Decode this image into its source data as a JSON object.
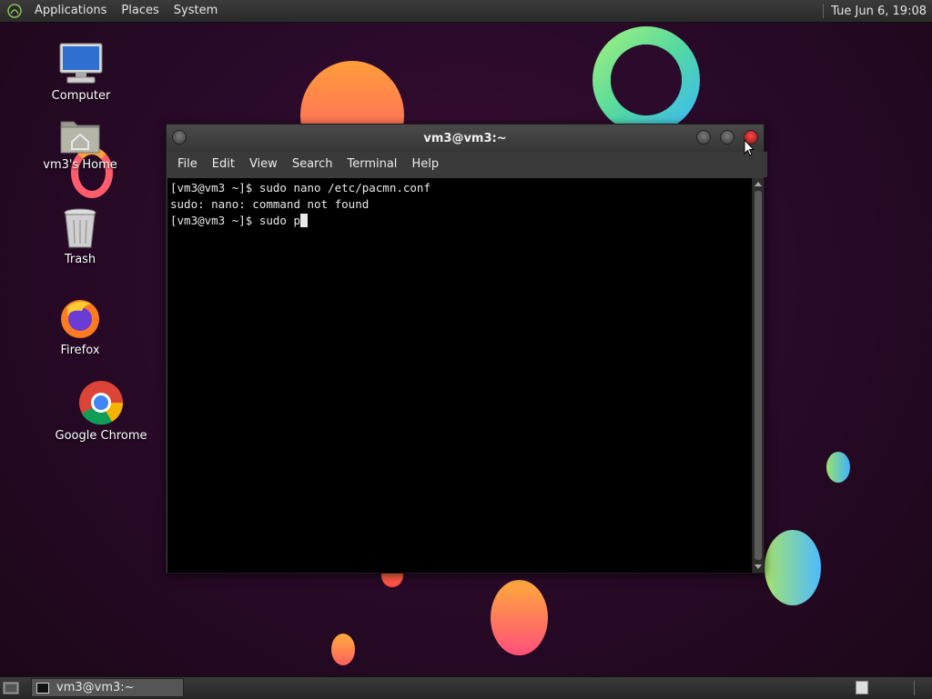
{
  "top_panel": {
    "menus": [
      "Applications",
      "Places",
      "System"
    ],
    "clock": "Tue Jun  6, 19:08",
    "logo_icon": "mate-logo-icon"
  },
  "desktop_icons": [
    {
      "label": "Computer",
      "icon": "computer-icon"
    },
    {
      "label": "vm3's Home",
      "icon": "home-folder-icon"
    },
    {
      "label": "Trash",
      "icon": "trash-icon"
    },
    {
      "label": "Firefox",
      "icon": "firefox-icon"
    },
    {
      "label": "Google Chrome",
      "icon": "chrome-icon"
    }
  ],
  "window": {
    "title": "vm3@vm3:~",
    "menu": [
      "File",
      "Edit",
      "View",
      "Search",
      "Terminal",
      "Help"
    ],
    "terminal_lines": [
      "[vm3@vm3 ~]$ sudo nano /etc/pacmn.conf",
      "sudo: nano: command not found",
      "[vm3@vm3 ~]$ sudo p"
    ],
    "close_color": "#e03030"
  },
  "bottom_panel": {
    "task_label": "vm3@vm3:~"
  },
  "colors": {
    "panel": "#2f2f2f",
    "wallpaper": "#2a0a2a",
    "terminal_bg": "#000000"
  }
}
